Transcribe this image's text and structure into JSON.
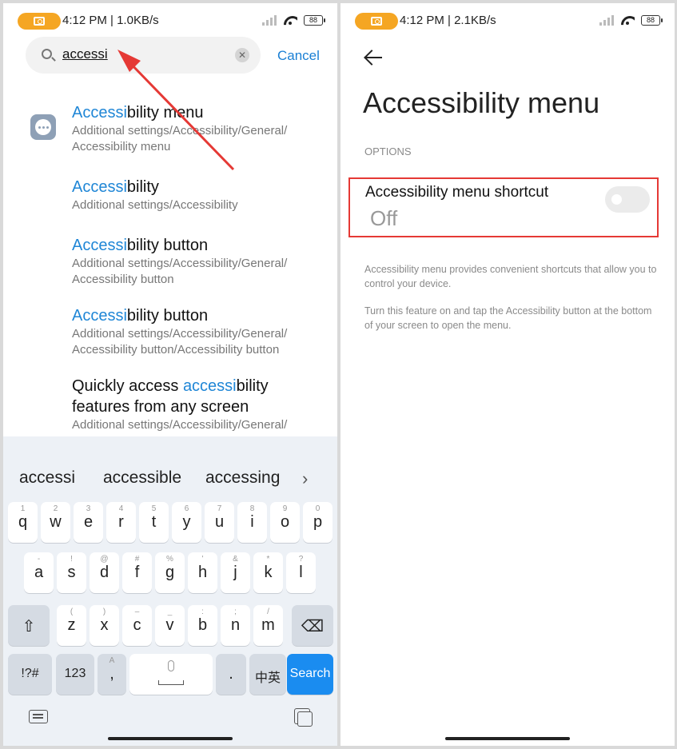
{
  "left": {
    "status": {
      "text": "4:12 PM | 1.0KB/s",
      "battery": "88"
    },
    "search": {
      "query": "accessi",
      "cancel_label": "Cancel"
    },
    "results": [
      {
        "pre": "",
        "hl": "Accessi",
        "post": "bility menu",
        "path": "Additional settings/Accessibility/General/ Accessibility menu"
      },
      {
        "pre": "",
        "hl": "Accessi",
        "post": "bility",
        "path": "Additional settings/Accessibility"
      },
      {
        "pre": "",
        "hl": "Accessi",
        "post": "bility button",
        "path": "Additional settings/Accessibility/General/ Accessibility button"
      },
      {
        "pre": "",
        "hl": "Accessi",
        "post": "bility button",
        "path": "Additional settings/Accessibility/General/ Accessibility button/Accessibility button"
      },
      {
        "pre": "Quickly access ",
        "hl": "accessi",
        "post": "bility features from any screen",
        "path": "Additional settings/Accessibility/General/"
      }
    ],
    "keyboard": {
      "suggestions": [
        "accessi",
        "accessible",
        "accessing"
      ],
      "row1": [
        {
          "k": "q",
          "s": "1"
        },
        {
          "k": "w",
          "s": "2"
        },
        {
          "k": "e",
          "s": "3"
        },
        {
          "k": "r",
          "s": "4"
        },
        {
          "k": "t",
          "s": "5"
        },
        {
          "k": "y",
          "s": "6"
        },
        {
          "k": "u",
          "s": "7"
        },
        {
          "k": "i",
          "s": "8"
        },
        {
          "k": "o",
          "s": "9"
        },
        {
          "k": "p",
          "s": "0"
        }
      ],
      "row2": [
        {
          "k": "a",
          "s": "-"
        },
        {
          "k": "s",
          "s": "!"
        },
        {
          "k": "d",
          "s": "@"
        },
        {
          "k": "f",
          "s": "#"
        },
        {
          "k": "g",
          "s": "%"
        },
        {
          "k": "h",
          "s": "'"
        },
        {
          "k": "j",
          "s": "&"
        },
        {
          "k": "k",
          "s": "*"
        },
        {
          "k": "l",
          "s": "?"
        }
      ],
      "row3": [
        {
          "k": "z",
          "s": "("
        },
        {
          "k": "x",
          "s": ")"
        },
        {
          "k": "c",
          "s": "–"
        },
        {
          "k": "v",
          "s": "_"
        },
        {
          "k": "b",
          "s": ":"
        },
        {
          "k": "n",
          "s": ";"
        },
        {
          "k": "m",
          "s": "/"
        }
      ],
      "symbols": "!?#",
      "numbers": "123",
      "comma": ",",
      "comma_sub": "A",
      "period": ".",
      "lang": "中英",
      "search": "Search"
    }
  },
  "right": {
    "status": {
      "text": "4:12 PM | 2.1KB/s",
      "battery": "88"
    },
    "title": "Accessibility menu",
    "section": "OPTIONS",
    "setting": {
      "title": "Accessibility menu shortcut",
      "value": "Off",
      "enabled": false
    },
    "desc1": "Accessibility menu provides convenient shortcuts that allow you to control your device.",
    "desc2": "Turn this feature on and tap the Accessibility button at the bottom of your screen to open the menu."
  },
  "colors": {
    "accent": "#1f86d6",
    "highlight_box": "#e53935",
    "arrow": "#e53935",
    "camera_pill": "#f5a623"
  }
}
